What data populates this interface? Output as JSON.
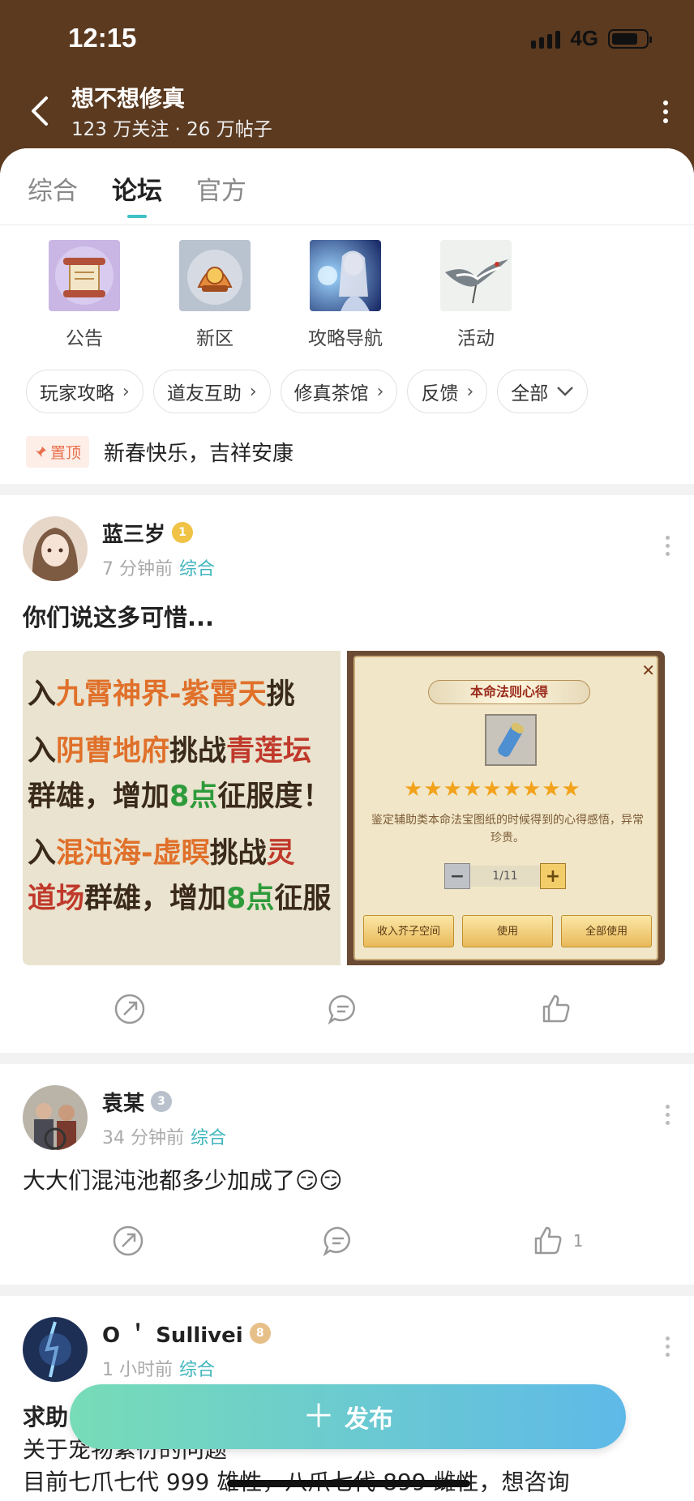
{
  "status_bar": {
    "time": "12:15",
    "network": "4G"
  },
  "header": {
    "title": "想不想修真",
    "stats": "123 万关注 · 26 万帖子"
  },
  "tabs": [
    {
      "label": "综合",
      "active": false
    },
    {
      "label": "论坛",
      "active": true
    },
    {
      "label": "官方",
      "active": false
    }
  ],
  "quick_links": [
    {
      "label": "公告"
    },
    {
      "label": "新区"
    },
    {
      "label": "攻略导航"
    },
    {
      "label": "活动"
    }
  ],
  "chips": [
    {
      "label": "玩家攻略"
    },
    {
      "label": "道友互助"
    },
    {
      "label": "修真茶馆"
    },
    {
      "label": "反馈"
    },
    {
      "label": "全部"
    }
  ],
  "pinned": {
    "badge": "置顶",
    "text": "新春快乐，吉祥安康"
  },
  "posts": [
    {
      "author": "蓝三岁",
      "level": "1",
      "time": "7 分钟前",
      "category": "综合",
      "title": "你们说这多可惜...",
      "likes": "",
      "image1_lines": [
        [
          "入",
          "九霄神界",
          "-",
          "紫霄天",
          "挑"
        ],
        [
          "入",
          "阴曹地府",
          "挑战",
          "青莲坛"
        ],
        [
          "群雄，增加",
          "8点",
          "征服度！"
        ],
        [
          "入",
          "混沌海",
          "-",
          "虚瞑",
          "挑战",
          "灵"
        ],
        [
          "道场",
          "群雄，增加",
          "8点",
          "征服"
        ]
      ],
      "image2": {
        "title": "本命法则心得",
        "desc": "鉴定辅助类本命法宝图纸的时候得到的心得感悟，异常珍贵。",
        "counter": "1/11",
        "btn_store": "收入芥子空间",
        "btn_use": "使用",
        "btn_use_all": "全部使用",
        "stars": 9
      }
    },
    {
      "author": "袁某",
      "level": "3",
      "time": "34 分钟前",
      "category": "综合",
      "body": "大大们混沌池都多少加成了😏😏",
      "likes": "1"
    },
    {
      "author": "O ＇ Sullivei",
      "level": "8",
      "time": "1 小时前",
      "category": "综合",
      "body_lines": [
        "求助",
        "关于宠物繁衍的问题",
        "目前七爪七代 999 雄性，八爪七代 899 雌性，想咨询"
      ]
    }
  ],
  "fab": {
    "label": "发布"
  },
  "colors": {
    "header_bg": "#5b3a20",
    "accent": "#41b6bd",
    "fab_start": "#77dcb7",
    "fab_end": "#5fb9e8"
  }
}
